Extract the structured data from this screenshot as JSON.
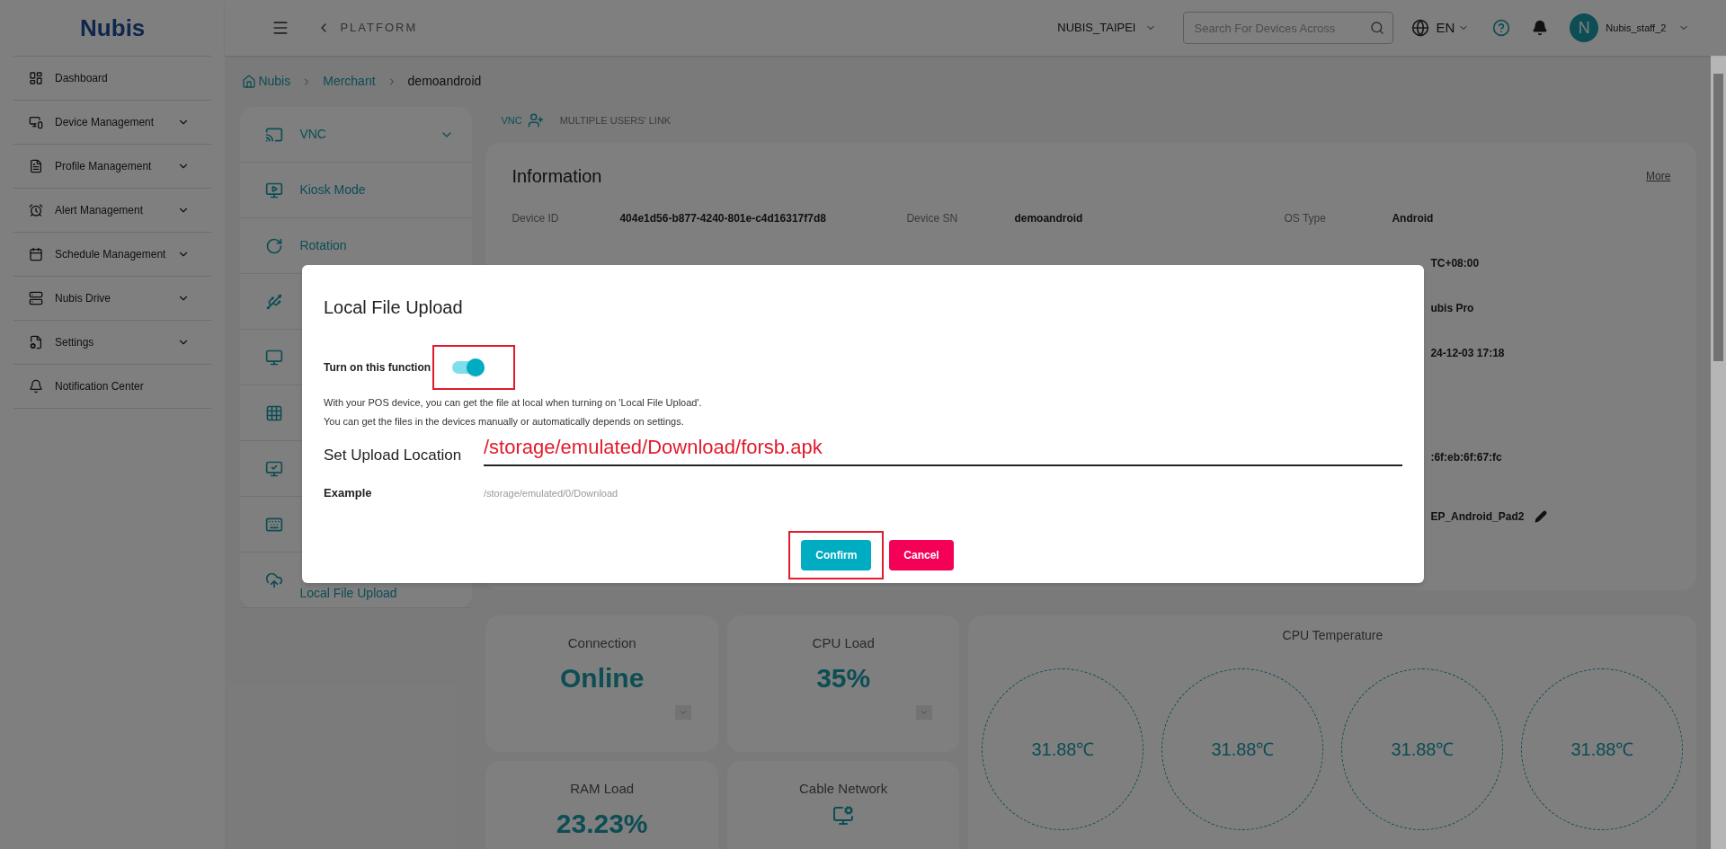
{
  "logo": "Nubis",
  "sidebar": {
    "items": [
      {
        "label": "Dashboard",
        "expandable": false
      },
      {
        "label": "Device Management",
        "expandable": true
      },
      {
        "label": "Profile Management",
        "expandable": true
      },
      {
        "label": "Alert Management",
        "expandable": true
      },
      {
        "label": "Schedule Management",
        "expandable": true
      },
      {
        "label": "Nubis Drive",
        "expandable": true
      },
      {
        "label": "Settings",
        "expandable": true
      },
      {
        "label": "Notification Center",
        "expandable": false
      }
    ]
  },
  "header": {
    "section": "PLATFORM",
    "merchant": "NUBIS_TAIPEI",
    "search": {
      "placeholder": "Search For Devices Across"
    },
    "language": "EN",
    "user": {
      "initial": "N",
      "name": "Nubis_staff_2"
    }
  },
  "breadcrumb": [
    "Nubis",
    "Merchant",
    "demoandroid"
  ],
  "feature_menu": [
    {
      "label": "VNC",
      "expandable": true
    },
    {
      "label": "Kiosk Mode",
      "expandable": false
    },
    {
      "label": "Rotation",
      "expandable": false
    },
    {
      "expandable": false
    },
    {
      "expandable": false
    },
    {
      "expandable": false
    },
    {
      "expandable": false
    },
    {
      "expandable": false
    },
    {
      "label": "Local File Upload",
      "expandable": false
    }
  ],
  "tabs": [
    {
      "label": "VNC",
      "selected": true
    },
    {
      "label": "MULTIPLE USERS' LINK",
      "selected": false
    }
  ],
  "information": {
    "title": "Information",
    "more": "More",
    "fields": [
      {
        "label": "Device ID",
        "value": "404e1d56-b877-4240-801e-c4d16317f7d8"
      },
      {
        "label": "Device SN",
        "value": "demoandroid"
      },
      {
        "label": "OS Type",
        "value": "Android"
      }
    ],
    "partial_values": [
      {
        "value": "TC+08:00",
        "editable": false
      },
      {
        "value": "ubis Pro",
        "editable": false
      },
      {
        "value": "24-12-03 17:18",
        "editable": false
      },
      {
        "value": ":6f:eb:6f:67:fc",
        "editable": false
      },
      {
        "value": "EP_Android_Pad2",
        "editable": true
      }
    ]
  },
  "stats": [
    {
      "title": "Connection",
      "value": "Online",
      "kind": "text"
    },
    {
      "title": "CPU Load",
      "value": "35%",
      "kind": "text"
    },
    {
      "title": "RAM Load",
      "value": "23.23%",
      "kind": "text"
    },
    {
      "title": "Cable Network",
      "kind": "icon"
    }
  ],
  "cpu_temperature": {
    "title": "CPU Temperature",
    "cores": [
      "31.88℃",
      "31.88℃",
      "31.88℃",
      "31.88℃"
    ]
  },
  "dialog": {
    "title": "Local File Upload",
    "toggle": {
      "label": "Turn on this function",
      "on": true,
      "highlighted": true
    },
    "description": [
      "With your POS device, you can get the file at local when turning on 'Local File Upload'.",
      "You can get the files in the devices manually or automatically depends on settings."
    ],
    "location": {
      "label": "Set Upload Location"
    },
    "example": {
      "label": "Example",
      "value": "/storage/emulated/0/Download"
    },
    "buttons": [
      {
        "label": "Confirm",
        "kind": "primary",
        "highlighted": true
      },
      {
        "label": "Cancel",
        "kind": "danger",
        "highlighted": false
      }
    ]
  },
  "annotation": {
    "text": "/storage/emulated/Download/forsb.apk"
  }
}
